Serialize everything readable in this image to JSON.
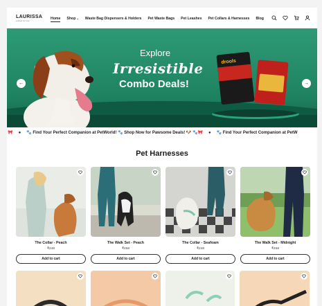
{
  "logo": {
    "title": "LAURISSA",
    "tagline": "crafted for love"
  },
  "nav": {
    "items": [
      {
        "label": "Home",
        "active": true
      },
      {
        "label": "Shop",
        "dropdown": true
      },
      {
        "label": "Waste Bag Dispensers & Holders"
      },
      {
        "label": "Pet Waste Bags"
      },
      {
        "label": "Pet Leashes"
      },
      {
        "label": "Pet Collars & Harnesses"
      },
      {
        "label": "Blog"
      }
    ],
    "icons": [
      "search-icon",
      "heart-icon",
      "cart-icon",
      "user-icon"
    ]
  },
  "banner": {
    "explore": "Explore",
    "irresistible": "Irresistible",
    "combo": "Combo Deals!",
    "pack_label": "drools",
    "colors": {
      "bg": "#1f8a66",
      "dark": "#0f5a42"
    }
  },
  "ticker": {
    "prefix": "🐾 🎀",
    "messages": [
      "🐾 Find Your Perfect Companion at PetWorld! 🐾 Shop Now for Pawsome Deals! 🐶 🐾🎀",
      "🐾 Find Your Perfect Companion at PetW"
    ]
  },
  "section": {
    "title": "Pet Harnesses",
    "products": [
      {
        "name": "The Collar - Peach",
        "price": "₹248",
        "button": "Add to cart"
      },
      {
        "name": "The Walk Set - Peach",
        "price": "₹458",
        "button": "Add to cart"
      },
      {
        "name": "The Collar - Seafoam",
        "price": "₹248",
        "button": "Add to cart"
      },
      {
        "name": "The Walk Set - Midnight",
        "price": "₹458",
        "button": "Add to cart"
      }
    ]
  }
}
